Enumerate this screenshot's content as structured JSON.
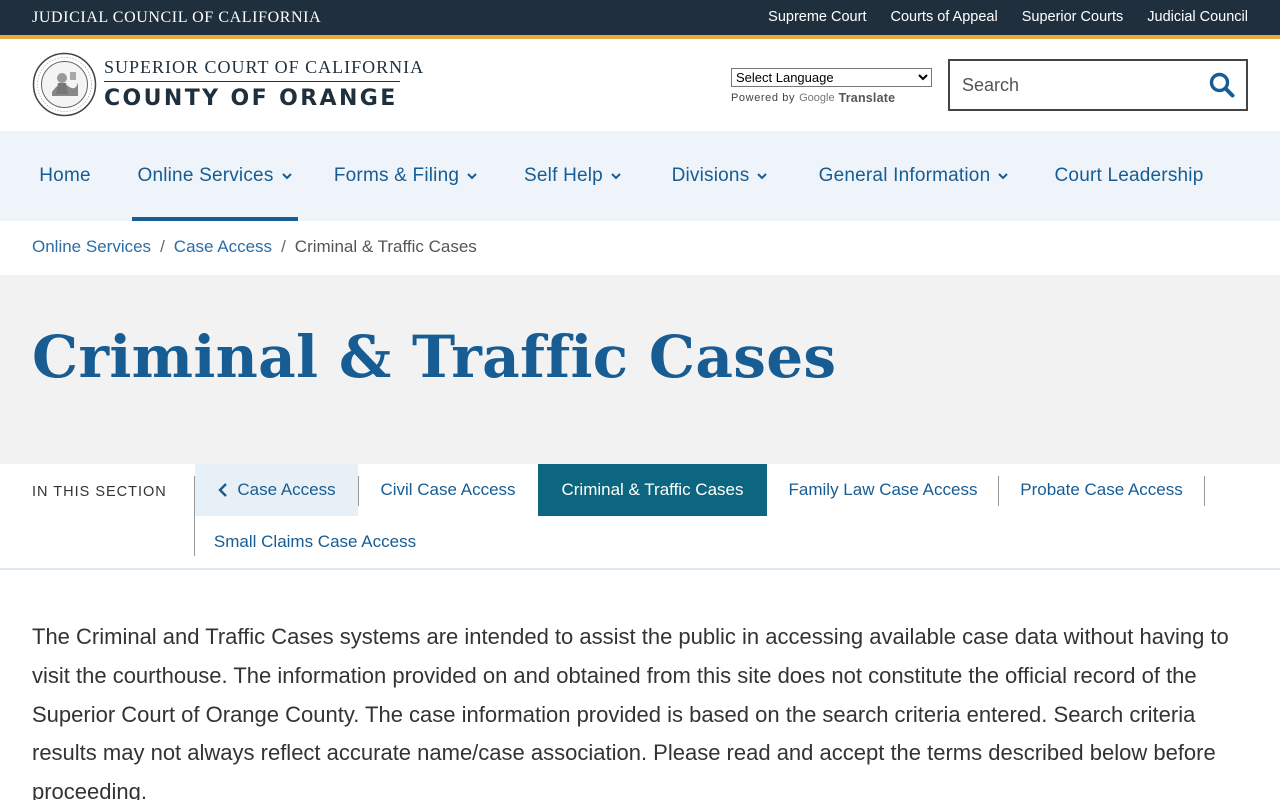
{
  "topbar": {
    "title": "JUDICIAL COUNCIL OF CALIFORNIA",
    "links": [
      "Supreme Court",
      "Courts of Appeal",
      "Superior Courts",
      "Judicial Council"
    ]
  },
  "header": {
    "logo_line1": "SUPERIOR COURT OF CALIFORNIA",
    "logo_line2": "COUNTY OF ORANGE",
    "language_select": "Select Language",
    "powered_by": "Powered by",
    "google": "Google",
    "translate": "Translate",
    "search_placeholder": "Search"
  },
  "nav": {
    "items": [
      {
        "label": "Home"
      },
      {
        "label": "Online Services"
      },
      {
        "label": "Forms & Filing"
      },
      {
        "label": "Self Help"
      },
      {
        "label": "Divisions"
      },
      {
        "label": "General Information"
      },
      {
        "label": "Court Leadership"
      }
    ]
  },
  "breadcrumb": {
    "items": [
      "Online Services",
      "Case Access"
    ],
    "current": "Criminal & Traffic Cases",
    "separator": "/"
  },
  "page": {
    "title": "Criminal & Traffic Cases"
  },
  "section": {
    "label": "IN THIS SECTION",
    "back": "Case Access",
    "items": [
      "Civil Case Access",
      "Criminal & Traffic Cases",
      "Family Law Case Access",
      "Probate Case Access",
      "Small Claims Case Access"
    ]
  },
  "content": {
    "intro": "The Criminal and Traffic Cases systems are intended to assist the public in accessing available case data without having to visit the courthouse. The information provided on and obtained from this site does not constitute the official record of the Superior Court of Orange County. The case information provided is based on the search criteria entered. Search criteria results may not always reflect accurate name/case association. Please read and accept the terms described below before proceeding."
  },
  "colors": {
    "topbar": "#1f2f3d",
    "accent": "#e8a93b",
    "link": "#175c93",
    "active_tab": "#0d6680",
    "nav_bg": "#eef4fa"
  }
}
